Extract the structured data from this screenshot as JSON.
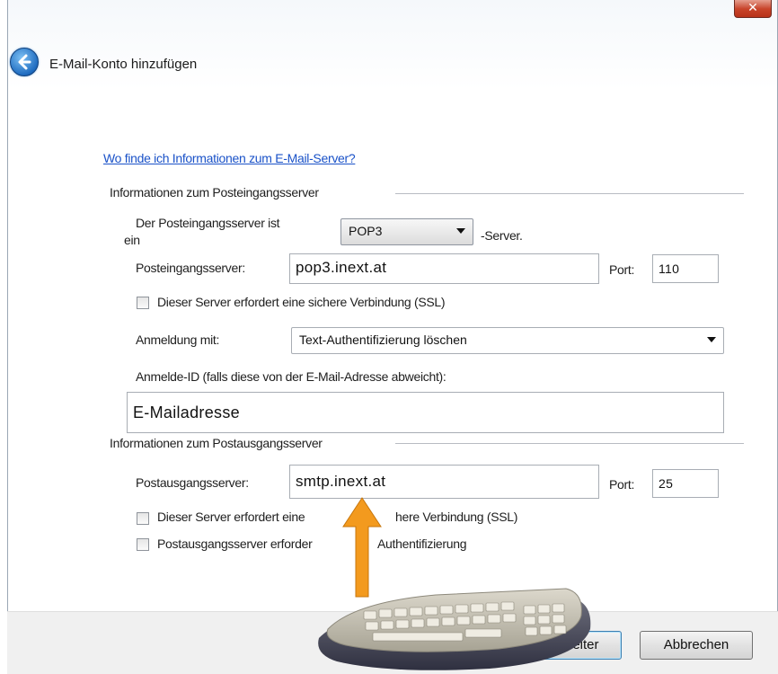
{
  "window": {
    "close_label": "✕"
  },
  "header": {
    "title": "E-Mail-Konto hinzufügen"
  },
  "help_link": "Wo finde ich Informationen zum E-Mail-Server?",
  "incoming": {
    "group_label": "Informationen zum Posteingangsserver",
    "server_type_label_1": "Der Posteingangsserver ist",
    "server_type_label_2": "ein",
    "server_type_value": "POP3",
    "server_suffix": "-Server.",
    "server_label": "Posteingangsserver:",
    "server_value": "pop3.inext.at",
    "port_label": "Port:",
    "port_value": "110",
    "ssl_label": "Dieser Server erfordert eine sichere Verbindung (SSL)",
    "login_label": "Anmeldung mit:",
    "login_value": "Text-Authentifizierung löschen",
    "id_label": "Anmelde-ID (falls diese von der E-Mail-Adresse abweicht):",
    "id_value": "E-Mailadresse"
  },
  "outgoing": {
    "group_label": "Informationen zum Postausgangsserver",
    "server_label": "Postausgangsserver:",
    "server_value": "smtp.inext.at",
    "port_label": "Port:",
    "port_value": "25",
    "ssl_label_a": "Dieser Server erfordert eine",
    "ssl_label_b": "here Verbindung (SSL)",
    "auth_label_a": "Postausgangsserver erforder",
    "auth_label_b": "Authentifizierung"
  },
  "footer": {
    "next_label": "Weiter",
    "cancel_label": "Abbrechen"
  },
  "colors": {
    "link": "#1a52c8",
    "arrow": "#f39a1e",
    "close": "#c8442a"
  }
}
